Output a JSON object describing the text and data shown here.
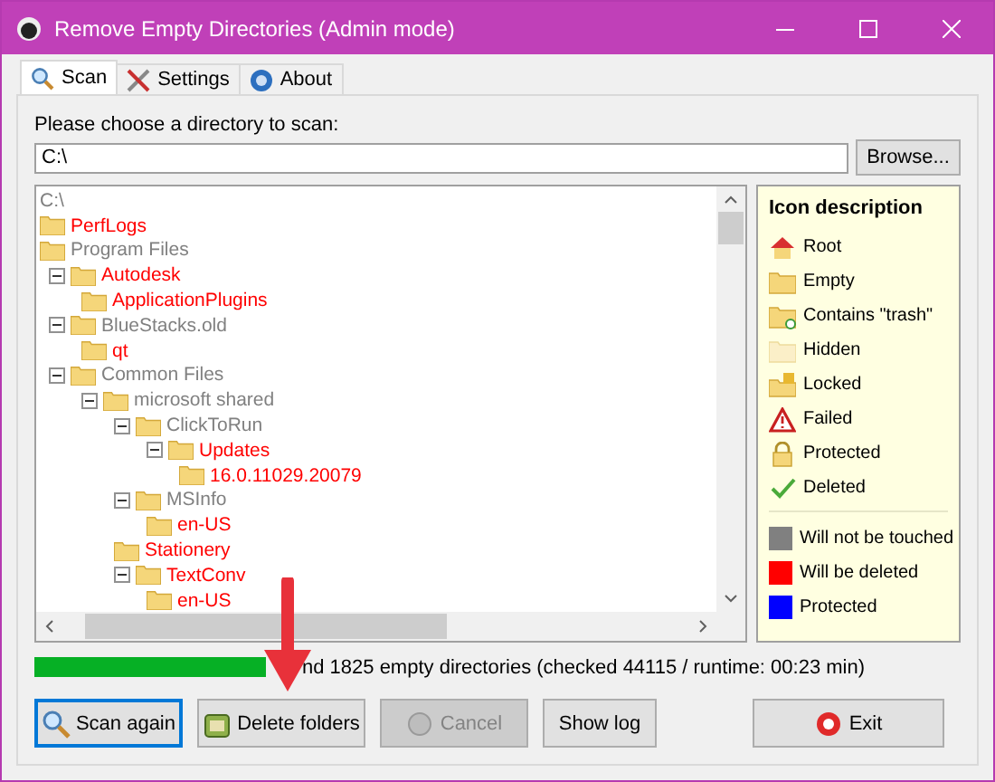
{
  "window": {
    "title": "Remove Empty Directories (Admin mode)"
  },
  "tabs": [
    {
      "label": "Scan",
      "selected": true
    },
    {
      "label": "Settings",
      "selected": false
    },
    {
      "label": "About",
      "selected": false
    }
  ],
  "directory": {
    "label": "Please choose a directory to scan:",
    "value": "C:\\",
    "browse": "Browse..."
  },
  "tree": {
    "label": "C:\\",
    "color": "#808080",
    "children": [
      {
        "label": "PerfLogs",
        "color": "#ff0000"
      },
      {
        "label": "Program Files",
        "color": "#808080",
        "children": [
          {
            "label": "Autodesk",
            "color": "#ff0000",
            "expanded": true,
            "children": [
              {
                "label": "ApplicationPlugins",
                "color": "#ff0000"
              }
            ]
          },
          {
            "label": "BlueStacks.old",
            "color": "#808080",
            "expanded": true,
            "children": [
              {
                "label": "qt",
                "color": "#ff0000"
              }
            ]
          },
          {
            "label": "Common Files",
            "color": "#808080",
            "expanded": true,
            "children": [
              {
                "label": "microsoft shared",
                "color": "#808080",
                "expanded": true,
                "children": [
                  {
                    "label": "ClickToRun",
                    "color": "#808080",
                    "expanded": true,
                    "children": [
                      {
                        "label": "Updates",
                        "color": "#ff0000",
                        "expanded": true,
                        "children": [
                          {
                            "label": "16.0.11029.20079",
                            "color": "#ff0000"
                          }
                        ]
                      }
                    ]
                  },
                  {
                    "label": "MSInfo",
                    "color": "#808080",
                    "expanded": true,
                    "children": [
                      {
                        "label": "en-US",
                        "color": "#ff0000"
                      }
                    ]
                  },
                  {
                    "label": "Stationery",
                    "color": "#ff0000"
                  },
                  {
                    "label": "TextConv",
                    "color": "#ff0000",
                    "expanded": true,
                    "children": [
                      {
                        "label": "en-US",
                        "color": "#ff0000"
                      }
                    ]
                  }
                ]
              }
            ]
          }
        ]
      }
    ]
  },
  "legend": {
    "title": "Icon description",
    "icons": [
      {
        "kind": "root",
        "label": "Root"
      },
      {
        "kind": "empty",
        "label": "Empty"
      },
      {
        "kind": "trash",
        "label": "Contains \"trash\""
      },
      {
        "kind": "hidden",
        "label": "Hidden"
      },
      {
        "kind": "locked",
        "label": "Locked"
      },
      {
        "kind": "failed",
        "label": "Failed"
      },
      {
        "kind": "protected",
        "label": "Protected"
      },
      {
        "kind": "deleted",
        "label": "Deleted"
      }
    ],
    "colors": [
      {
        "color": "#808080",
        "label": "Will not be touched"
      },
      {
        "color": "#ff0000",
        "label": "Will be deleted"
      },
      {
        "color": "#0000ff",
        "label": "Protected"
      }
    ]
  },
  "progress": {
    "level": 1,
    "text": "nd 1825 empty directories (checked 44115 / runtime: 00:23 min)"
  },
  "buttons": [
    {
      "kind": "scan",
      "label": "Scan again",
      "disabled": false,
      "focused": true
    },
    {
      "kind": "delete",
      "label": "Delete folders",
      "disabled": false,
      "focused": false
    },
    {
      "kind": "cancel",
      "label": "Cancel",
      "disabled": true,
      "focused": false
    },
    {
      "kind": "log",
      "label": "Show log",
      "disabled": false,
      "focused": false
    },
    {
      "kind": "exit",
      "label": "Exit",
      "disabled": false,
      "focused": false
    }
  ]
}
